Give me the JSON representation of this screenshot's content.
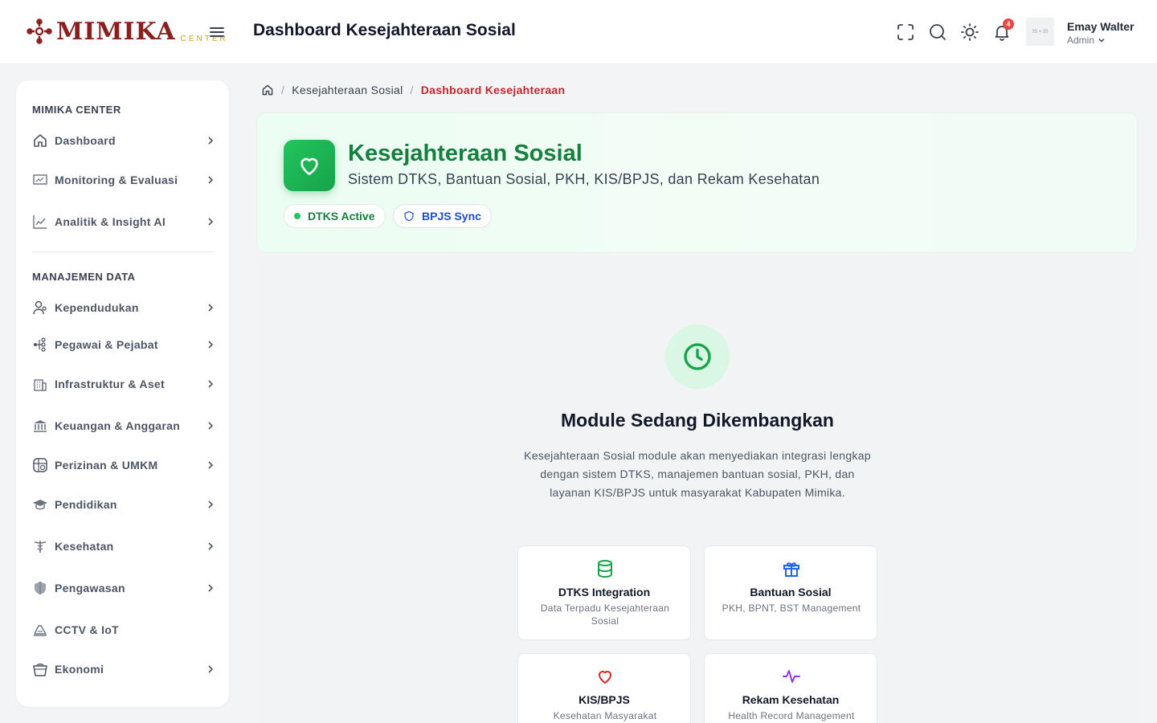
{
  "header": {
    "logo_text": "MIMIKA",
    "logo_sub": "CENTER",
    "title": "Dashboard Kesejahteraan Sosial",
    "notification_count": "4",
    "avatar_placeholder": "35 × 35",
    "user_name": "Emay Walter",
    "user_role": "Admin"
  },
  "sidebar": {
    "section1": "MIMIKA CENTER",
    "section2": "MANAJEMEN DATA",
    "items": [
      {
        "label": "Dashboard",
        "icon": "home-icon"
      },
      {
        "label": "Monitoring & Evaluasi",
        "icon": "monitor-icon"
      },
      {
        "label": "Analitik & Insight AI",
        "icon": "chart-icon"
      },
      {
        "label": "Kependudukan",
        "icon": "users-icon"
      },
      {
        "label": "Pegawai & Pejabat",
        "icon": "org-icon"
      },
      {
        "label": "Infrastruktur & Aset",
        "icon": "building-icon"
      },
      {
        "label": "Keuangan & Anggaran",
        "icon": "bank-icon"
      },
      {
        "label": "Perizinan & UMKM",
        "icon": "license-icon"
      },
      {
        "label": "Pendidikan",
        "icon": "graduation-icon"
      },
      {
        "label": "Kesehatan",
        "icon": "health-icon"
      },
      {
        "label": "Pengawasan",
        "icon": "shield-icon"
      },
      {
        "label": "CCTV & IoT",
        "icon": "camera-icon"
      },
      {
        "label": "Ekonomi",
        "icon": "basket-icon"
      }
    ]
  },
  "breadcrumb": {
    "level1": "Kesejahteraan Sosial",
    "active": "Dashboard Kesejahteraan"
  },
  "hero": {
    "title": "Kesejahteraan Sosial",
    "subtitle": "Sistem DTKS, Bantuan Sosial, PKH, KIS/BPJS, dan Rekam Kesehatan",
    "badge_dtks": "DTKS Active",
    "badge_bpjs": "BPJS Sync"
  },
  "main": {
    "title": "Module Sedang Dikembangkan",
    "description": "Kesejahteraan Sosial module akan menyediakan integrasi lengkap dengan sistem DTKS, manajemen bantuan sosial, PKH, dan layanan KIS/BPJS untuk masyarakat Kabupaten Mimika.",
    "features": [
      {
        "title": "DTKS Integration",
        "desc": "Data Terpadu Kesejahteraan Sosial",
        "color": "#16a34a"
      },
      {
        "title": "Bantuan Sosial",
        "desc": "PKH, BPNT, BST Management",
        "color": "#2563eb"
      },
      {
        "title": "KIS/BPJS",
        "desc": "Kesehatan Masyarakat",
        "color": "#dc2626"
      },
      {
        "title": "Rekam Kesehatan",
        "desc": "Health Record Management",
        "color": "#9333ea"
      }
    ]
  },
  "colors": {
    "brand": "#8b1e1e",
    "accent_green": "#16a34a",
    "breadcrumb_active": "#c0262d"
  }
}
